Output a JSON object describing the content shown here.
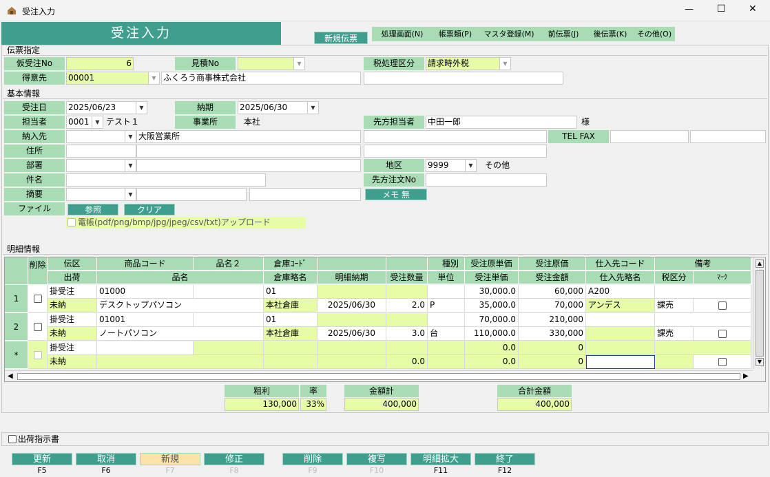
{
  "window": {
    "title": "受注入力",
    "minimize": "—",
    "maximize": "☐",
    "close": "✕"
  },
  "header": {
    "title": "受注入力",
    "new_label": "新規伝票"
  },
  "menu": [
    {
      "label": "処理画面(N)"
    },
    {
      "label": "帳票類(P)"
    },
    {
      "label": "マスタ登録(M)"
    },
    {
      "label": "前伝票(J)"
    },
    {
      "label": "後伝票(K)"
    },
    {
      "label": "その他(O)"
    }
  ],
  "sections": {
    "slip": "伝票指定",
    "basic": "基本情報",
    "detail": "明細情報"
  },
  "slip": {
    "temp_no_label": "仮受注No",
    "temp_no": "6",
    "quote_no_label": "見積No",
    "quote_no": "",
    "tax_label": "税処理区分",
    "tax_value": "請求時外税",
    "customer_label": "得意先",
    "customer_code": "00001",
    "customer_name": "ふくろう商事株式会社",
    "customer_extra": ""
  },
  "basic": {
    "order_date_label": "受注日",
    "order_date": "2025/06/23",
    "due_label": "納期",
    "due_date": "2025/06/30",
    "staff_label": "担当者",
    "staff_code": "0001",
    "staff_name": "テスト１",
    "office_label": "事業所",
    "office_value": "本社",
    "contact_label": "先方担当者",
    "contact_value": "中田一郎",
    "contact_suffix": "様",
    "delivery_label": "納入先",
    "delivery_name": "大阪営業所",
    "telfax_label": "TEL FAX",
    "address_label": "住所",
    "dept_label": "部署",
    "region_label": "地区",
    "region_code": "9999",
    "region_name": "その他",
    "subject_label": "件名",
    "client_order_label": "先方注文No",
    "memo_label": "摘要",
    "memo_button": "メモ 無",
    "file_label": "ファイル",
    "browse_button": "参照",
    "clear_button": "クリア",
    "upload_label": "電帳(pdf/png/bmp/jpg/jpeg/csv/txt)アップロード"
  },
  "grid": {
    "h1": [
      "削除",
      "伝区",
      "商品コード",
      "品名２",
      "倉庫ｺｰﾄﾞ",
      "",
      "",
      "種別",
      "受注原単価",
      "受注原価",
      "仕入先コード",
      "備考"
    ],
    "h2": [
      "出荷",
      "品名",
      "倉庫略名",
      "明細納期",
      "受注数量",
      "単位",
      "受注単価",
      "受注金額",
      "仕入先略名",
      "税区分",
      "ﾏｰｸ"
    ],
    "rows": [
      {
        "num": "1",
        "type": "掛受注",
        "code": "01000",
        "name2": "",
        "wh": "01",
        "cost_unit": "30,000.0",
        "cost": "60,000",
        "supplier": "A200",
        "ship": "未納",
        "name": "デスクトップパソコン",
        "wh_name": "本社倉庫",
        "ddate": "2025/06/30",
        "qty": "2.0",
        "unit": "P",
        "price": "35,000.0",
        "amount": "70,000",
        "sup_name": "アンデス",
        "tax": "課売"
      },
      {
        "num": "2",
        "type": "掛受注",
        "code": "01001",
        "name2": "",
        "wh": "01",
        "cost_unit": "70,000.0",
        "cost": "210,000",
        "supplier": "",
        "ship": "未納",
        "name": "ノートパソコン",
        "wh_name": "本社倉庫",
        "ddate": "2025/06/30",
        "qty": "3.0",
        "unit": "台",
        "price": "110,000.0",
        "amount": "330,000",
        "sup_name": "",
        "tax": "課売"
      },
      {
        "num": "*",
        "type": "掛受注",
        "code": "",
        "name2": "",
        "wh": "",
        "cost_unit": "0.0",
        "cost": "0",
        "supplier": "",
        "ship": "未納",
        "name": "",
        "wh_name": "",
        "ddate": "",
        "qty": "0.0",
        "unit": "",
        "price": "0.0",
        "amount": "0",
        "sup_name": "",
        "tax": ""
      }
    ]
  },
  "totals": {
    "profit_label": "粗利",
    "profit": "130,000",
    "rate_label": "率",
    "rate": "33%",
    "sum_label": "金額計",
    "sum": "400,000",
    "total_label": "合計金額",
    "total": "400,000"
  },
  "shipping_label": "出荷指示書",
  "footer": [
    {
      "label": "更新",
      "key": "F5"
    },
    {
      "label": "取消",
      "key": "F6"
    },
    {
      "label": "新規",
      "key": "F7"
    },
    {
      "label": "修正",
      "key": "F8"
    },
    {
      "label": "削除",
      "key": "F9"
    },
    {
      "label": "複写",
      "key": "F10"
    },
    {
      "label": "明細拡大",
      "key": "F11"
    },
    {
      "label": "終了",
      "key": "F12"
    }
  ],
  "colors": {
    "header": "#3f9e8e",
    "label": "#a8dcb4",
    "input_yellow": "#e6fca6"
  }
}
